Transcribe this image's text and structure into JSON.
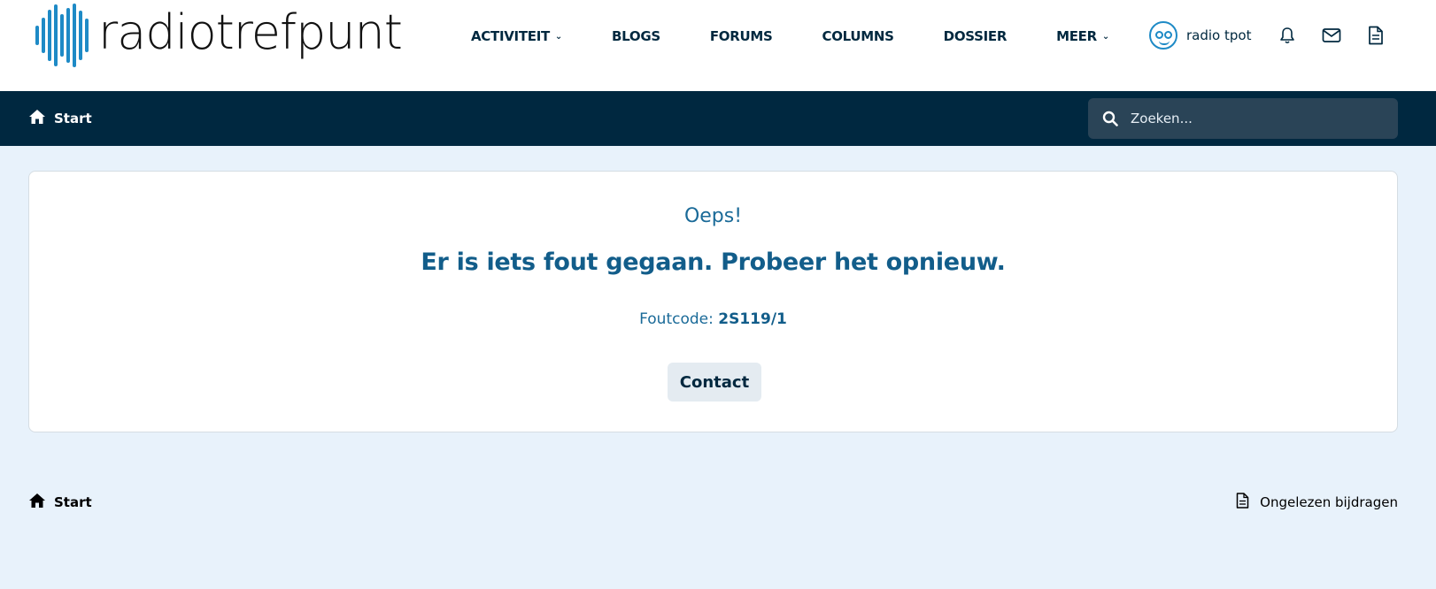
{
  "header": {
    "logo_text": "radiotrefpunt",
    "nav": [
      {
        "label": "ACTIVITEIT",
        "has_dropdown": true
      },
      {
        "label": "BLOGS",
        "has_dropdown": false
      },
      {
        "label": "FORUMS",
        "has_dropdown": false
      },
      {
        "label": "COLUMNS",
        "has_dropdown": false
      },
      {
        "label": "DOSSIER",
        "has_dropdown": false
      },
      {
        "label": "MEER",
        "has_dropdown": true
      }
    ],
    "user": {
      "name": "radio tpot"
    },
    "icons": [
      "bell-icon",
      "envelope-icon",
      "document-icon"
    ]
  },
  "subnav": {
    "start_label": "Start",
    "search": {
      "placeholder": "Zoeken..."
    }
  },
  "error": {
    "title": "Oeps!",
    "message": "Er is iets fout gegaan. Probeer het opnieuw.",
    "code_label": "Foutcode:",
    "code_value": "2S119/1",
    "contact_label": "Contact"
  },
  "footer": {
    "start_label": "Start",
    "unread_label": "Ongelezen bijdragen"
  },
  "colors": {
    "accent": "#1e8ac6",
    "navy": "#002840",
    "page_bg": "#e8f2fb",
    "error_text": "#125d8a"
  }
}
